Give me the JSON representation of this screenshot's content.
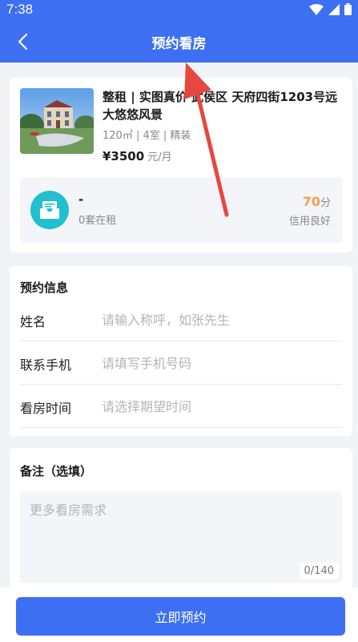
{
  "status_bar": {
    "time": "7:38"
  },
  "nav": {
    "title": "预约看房"
  },
  "house": {
    "title": "整租 | 实图真价 武侯区 天府四街1203号远大悠悠风景",
    "meta": "120㎡ | 4室 | 精装",
    "price": "¥3500",
    "price_unit": "元/月"
  },
  "landlord": {
    "name": "-",
    "listing_count": "0套在租",
    "credit_score": "70",
    "credit_unit": "分",
    "credit_label": "信用良好"
  },
  "form": {
    "section_title": "预约信息",
    "name_label": "姓名",
    "name_placeholder": "请输入称呼，如张先生",
    "phone_label": "联系手机",
    "phone_placeholder": "请填写手机号码",
    "time_label": "看房时间",
    "time_placeholder": "请选择期望时间"
  },
  "note": {
    "section_title": "备注（选填）",
    "placeholder": "更多看房需求",
    "counter": "0/140"
  },
  "submit": {
    "label": "立即预约"
  },
  "colors": {
    "primary": "#3d6ff2",
    "score": "#f5a04e",
    "avatar": "#21bfcf",
    "annotation_arrow": "#e8473f"
  },
  "icons": [
    "back-arrow-icon",
    "wifi-icon",
    "signal-icon",
    "battery-icon",
    "landlord-avatar-icon"
  ]
}
